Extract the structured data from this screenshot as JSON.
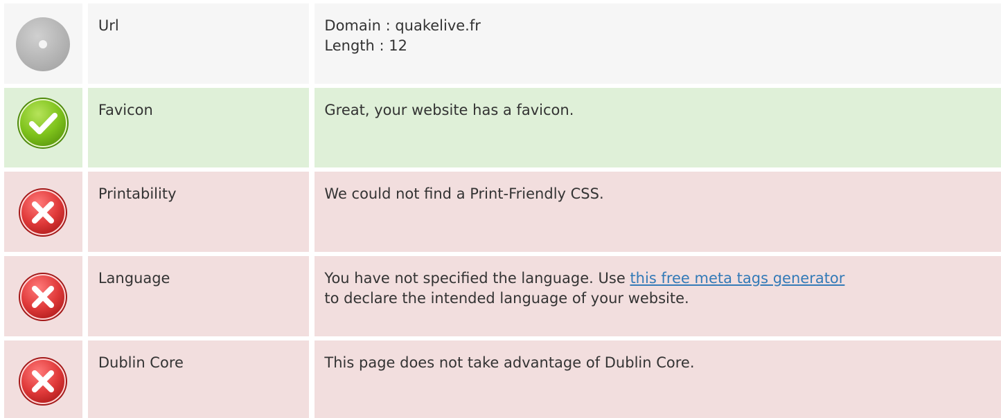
{
  "rows": [
    {
      "status": "neutral",
      "icon": "neutral-circle-icon",
      "label": "Url",
      "lines": [
        "Domain : quakelive.fr",
        "Length : 12"
      ]
    },
    {
      "status": "good",
      "icon": "check-icon",
      "label": "Favicon",
      "text": "Great, your website has a favicon."
    },
    {
      "status": "bad",
      "icon": "error-x-icon",
      "label": "Printability",
      "text": "We could not find a Print-Friendly CSS."
    },
    {
      "status": "bad",
      "icon": "error-x-icon",
      "label": "Language",
      "text_before": "You have not specified the language. Use ",
      "link_text": "this free meta tags generator",
      "text_after": "to declare the intended language of your website."
    },
    {
      "status": "bad",
      "icon": "error-x-icon",
      "label": "Dublin Core",
      "text": "This page does not take advantage of Dublin Core."
    }
  ],
  "colors": {
    "neutral_bg": "#f6f6f6",
    "good_bg": "#dff0d8",
    "bad_bg": "#f2dede",
    "link": "#337ab7",
    "check_green": "#7fc31c",
    "error_red": "#e03a3a",
    "neutral_gray": "#b3b3b3"
  }
}
